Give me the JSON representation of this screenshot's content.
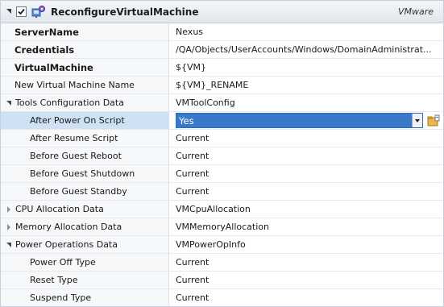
{
  "header": {
    "title": "ReconfigureVirtualMachine",
    "vendor": "VMware",
    "checked": true
  },
  "rows": [
    {
      "label": "ServerName",
      "value": "Nexus",
      "style": "bold"
    },
    {
      "label": "Credentials",
      "value": "/QA/Objects/UserAccounts/Windows/DomainAdministrat...",
      "style": "bold"
    },
    {
      "label": "VirtualMachine",
      "value": "${VM}",
      "style": "bold"
    },
    {
      "label": "New Virtual Machine Name",
      "value": "${VM}_RENAME",
      "style": "normal"
    },
    {
      "label": "Tools Configuration Data",
      "value": "VMToolConfig",
      "style": "group-open"
    },
    {
      "label": "After Power On Script",
      "value": "Yes",
      "style": "child-selected"
    },
    {
      "label": "After Resume Script",
      "value": "Current",
      "style": "child"
    },
    {
      "label": "Before Guest Reboot",
      "value": "Current",
      "style": "child"
    },
    {
      "label": "Before Guest Shutdown",
      "value": "Current",
      "style": "child"
    },
    {
      "label": "Before Guest Standby",
      "value": "Current",
      "style": "child"
    },
    {
      "label": "CPU Allocation Data",
      "value": "VMCpuAllocation",
      "style": "group-closed"
    },
    {
      "label": "Memory Allocation Data",
      "value": "VMMemoryAllocation",
      "style": "group-closed"
    },
    {
      "label": "Power Operations Data",
      "value": "VMPowerOpInfo",
      "style": "group-open"
    },
    {
      "label": "Power Off Type",
      "value": "Current",
      "style": "child"
    },
    {
      "label": "Reset Type",
      "value": "Current",
      "style": "child"
    },
    {
      "label": "Suspend Type",
      "value": "Current",
      "style": "child"
    }
  ],
  "icons": {
    "header": "vm-gear-icon",
    "dropdown": "chevron-down-icon",
    "extra": "folder-icon"
  },
  "colors": {
    "selection": "#3a78c9",
    "row_selected_label": "#cfe1f5"
  }
}
